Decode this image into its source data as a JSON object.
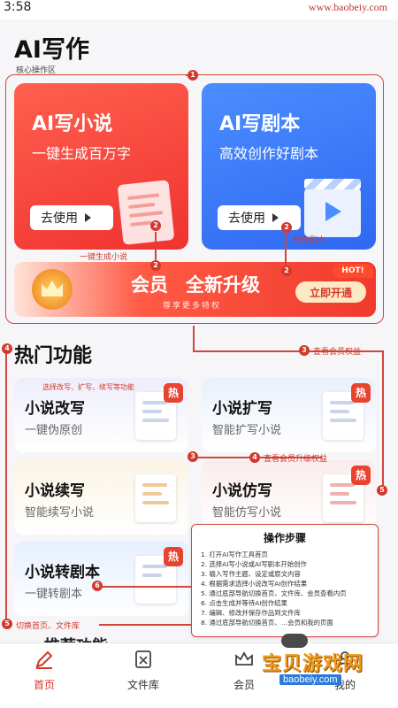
{
  "status": {
    "time": "3:58",
    "site": "www.baobeiy.com"
  },
  "page": {
    "title": "AI写作"
  },
  "core": {
    "label": "核心操作区",
    "cards": [
      {
        "title": "AI写小说",
        "subtitle": "一键生成百万字",
        "button": "去使用",
        "color": "#f0322e",
        "icon": "document-pen-icon"
      },
      {
        "title": "AI写剧本",
        "subtitle": "高效创作好剧本",
        "button": "去使用",
        "color": "#2f68f2",
        "icon": "clapperboard-icon"
      }
    ],
    "vip": {
      "word1": "会员",
      "word2": "全新升级",
      "subtitle": "尊享更多特权",
      "button": "立即开通",
      "hot": "HOT!",
      "icon": "crown-icon"
    }
  },
  "hot": {
    "title": "热门功能",
    "items": [
      {
        "title": "小说改写",
        "subtitle": "一键伪原创",
        "badge": "热"
      },
      {
        "title": "小说扩写",
        "subtitle": "智能扩写小说",
        "badge": "热"
      },
      {
        "title": "小说续写",
        "subtitle": "智能续写小说",
        "badge": ""
      },
      {
        "title": "小说仿写",
        "subtitle": "智能仿写小说",
        "badge": "热"
      },
      {
        "title": "小说转剧本",
        "subtitle": "一键转剧本",
        "badge": "热"
      }
    ],
    "hidden_title": "推荐功能"
  },
  "annotations": {
    "novel_gen": "一键生成小说",
    "script_create": "创作剧本",
    "view_vip": "查看会员权益",
    "rewrite_hint": "选择改写、扩写、续写等功能",
    "vip_upgrade": "查看会员升级权益",
    "switch_tabs": "切换首页、文件库",
    "nums": [
      "1",
      "2",
      "2",
      "2",
      "3",
      "3",
      "4",
      "4",
      "5",
      "5",
      "6"
    ]
  },
  "steps": {
    "title": "操作步骤",
    "items": [
      "1. 打开AI写作工具首页",
      "2. 选择AI写小说或AI写剧本开始创作",
      "3. 输入写作主题、设定或原文内容",
      "4. 根据需求选择小说改写AI创作结果",
      "5. 通过底部导航切换首页、文件库、会员查看内页",
      "6. 点击生成并等待AI创作结果",
      "7. 编辑、修改并保存作品到文件库",
      "8. 通过底部导航切换首页、…会员和我的页面"
    ]
  },
  "tabbar": {
    "items": [
      {
        "label": "首页",
        "icon": "pen-icon",
        "active": true
      },
      {
        "label": "文件库",
        "icon": "file-text-icon",
        "active": false
      },
      {
        "label": "会员",
        "icon": "crown-outline-icon",
        "active": false
      },
      {
        "label": "我的",
        "icon": "user-icon",
        "active": false
      }
    ]
  },
  "watermark": {
    "big": "宝贝游戏网",
    "small": "baobeiy.com"
  },
  "colors": {
    "accent": "#d2382b",
    "red_card": "#f0322e",
    "blue_card": "#2f68f2"
  }
}
